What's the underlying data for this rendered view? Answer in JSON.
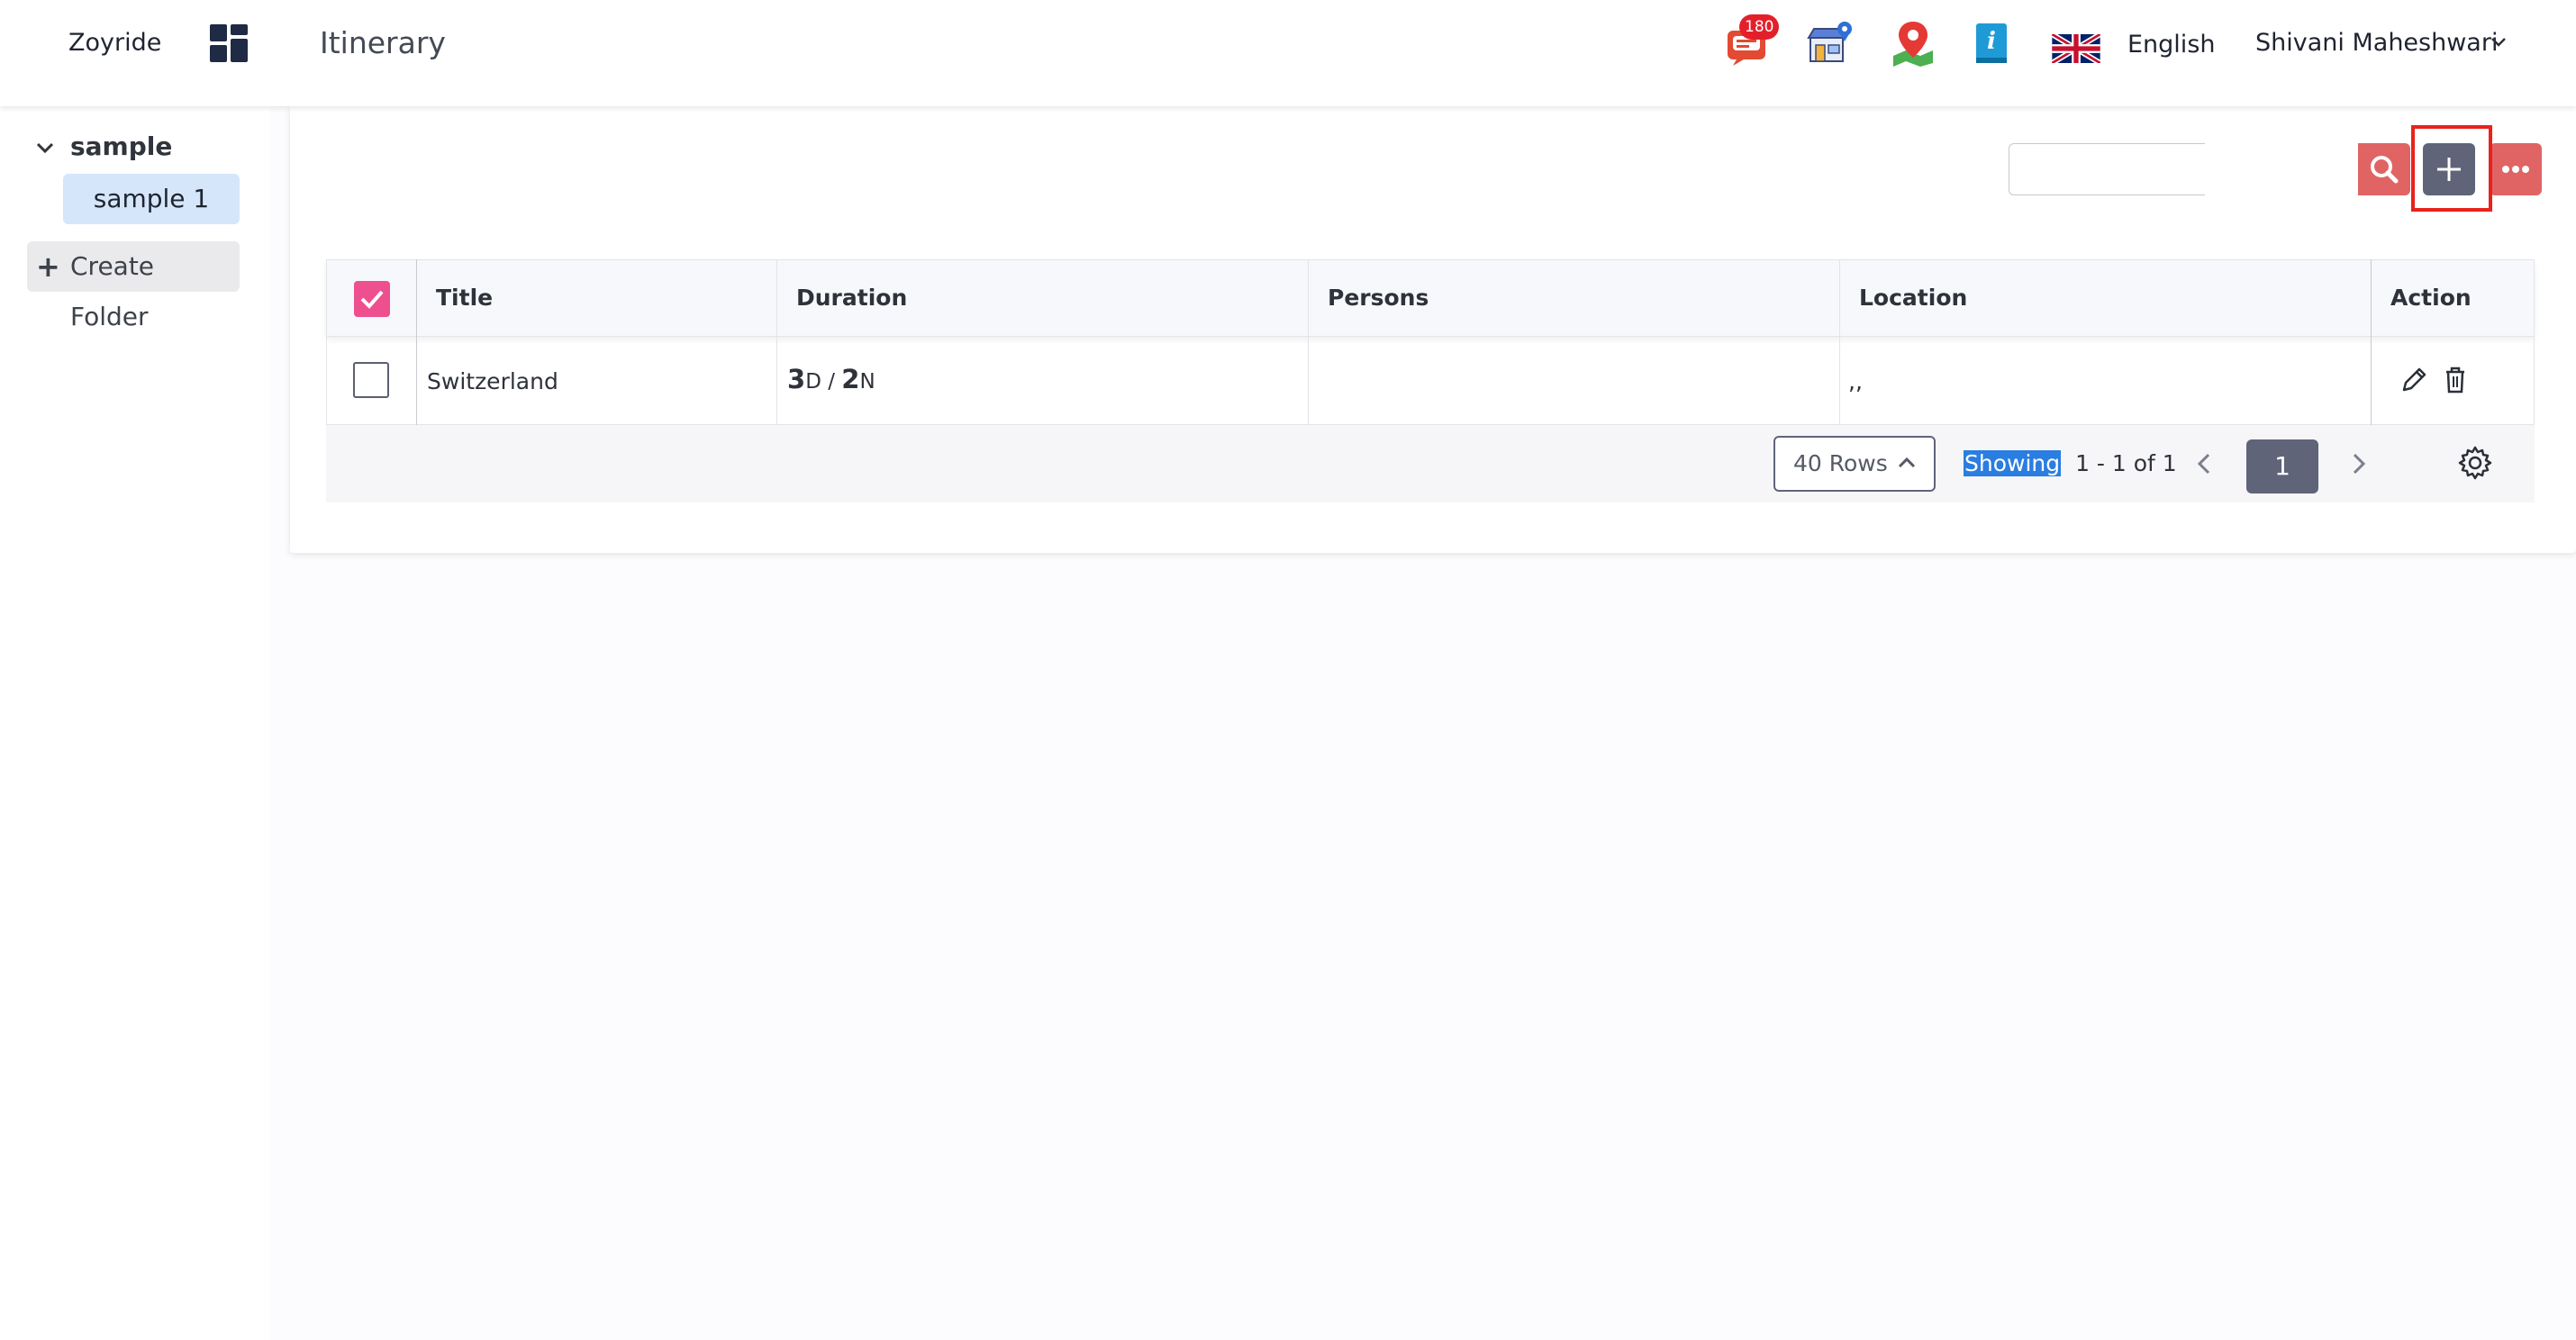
{
  "header": {
    "brand": "Zoyride",
    "title": "Itinerary",
    "notification_count": "180",
    "language": "English",
    "user_name": "Shivani Maheshwari",
    "icons": [
      "apps-grid-icon",
      "chat-notification-icon",
      "store-location-icon",
      "map-pin-icon",
      "info-book-icon",
      "uk-flag-icon",
      "chevron-down-icon"
    ]
  },
  "sidebar": {
    "root": "sample",
    "child": "sample 1",
    "create_folder": "Create Folder"
  },
  "toolbar": {
    "search_placeholder": "",
    "icons": [
      "search-icon",
      "plus-icon",
      "more-icon"
    ]
  },
  "table": {
    "columns": [
      "Title",
      "Duration",
      "Persons",
      "Location",
      "Action"
    ],
    "rows": [
      {
        "title": "Switzerland",
        "duration_days": "3",
        "duration_days_unit": "D",
        "duration_sep": " / ",
        "duration_nights": "2",
        "duration_nights_unit": "N",
        "persons": "",
        "location": ",,"
      }
    ]
  },
  "pager": {
    "rows_per_page": "40 Rows",
    "showing_label": "Showing",
    "range": "1 - 1 of 1",
    "current_page": "1"
  },
  "colors": {
    "accent_red": "#e06464",
    "slate": "#5f6478",
    "checkbox_pink": "#ee4f8e",
    "highlight_red": "#e8231c",
    "badge_red": "#e3202a",
    "selected_folder": "#d5e6fb"
  }
}
